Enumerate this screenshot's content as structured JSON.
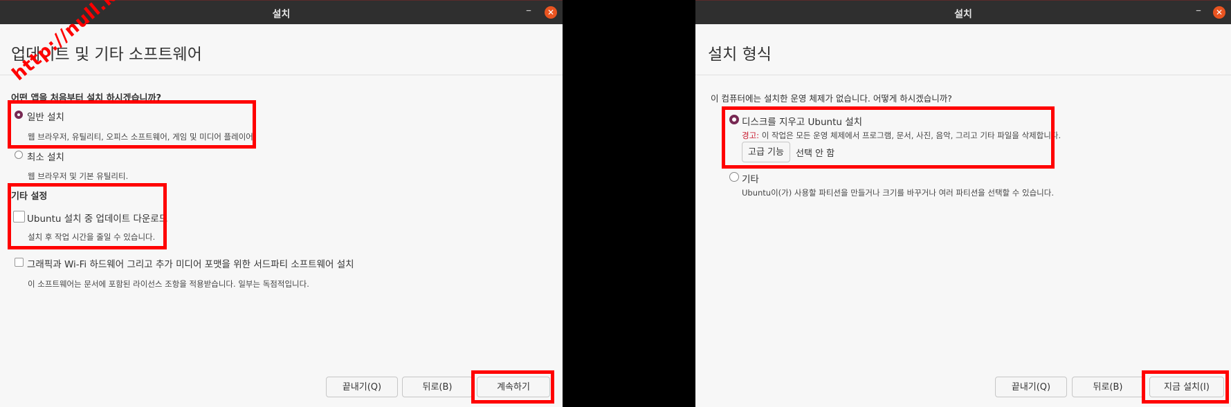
{
  "left": {
    "title": "설치",
    "minimize_glyph": "–",
    "close_glyph": "✕",
    "heading": "업데이트 및 기타 소프트웨어",
    "question": "어떤 앱을 처음부터 설치 하시겠습니까?",
    "normal_install": {
      "label": "일반 설치",
      "desc": "웹 브라우저, 유틸리티, 오피스 소프트웨어, 게임 및 미디어 플레이어.",
      "selected": true
    },
    "minimal_install": {
      "label": "최소 설치",
      "desc": "웹 브라우저 및 기본 유틸리티.",
      "selected": false
    },
    "other_settings": "기타 설정",
    "download_updates": {
      "label": "Ubuntu 설치 중 업데이트 다운로드",
      "desc": "설치 후 작업 시간을 줄일 수 있습니다.",
      "checked": false
    },
    "third_party": {
      "label": "그래픽과 Wi-Fi 하드웨어 그리고 추가 미디어 포맷을 위한 서드파티 소프트웨어 설치",
      "desc": "이 소프트웨어는 문서에 포함된 라이선스 조항을 적용받습니다. 일부는 독점적입니다.",
      "checked": false
    },
    "buttons": {
      "quit": "끝내기(Q)",
      "back": "뒤로(B)",
      "continue": "계속하기"
    }
  },
  "right": {
    "title": "설치",
    "minimize_glyph": "–",
    "close_glyph": "✕",
    "heading": "설치 형식",
    "question": "이 컴퓨터에는 설치한 운영 체제가 없습니다. 어떻게 하시겠습니까?",
    "erase_disk": {
      "label": "디스크를 지우고 Ubuntu 설치",
      "selected": true
    },
    "warning_label": "경고:",
    "warning_text": " 이 작업은 모든 운영 체제에서 프로그램, 문서, 사진, 음악, 그리고 기타 파일을 삭제합니다.",
    "advanced_button": "고급 기능",
    "advanced_status": "선택 안 함",
    "other": {
      "label": "기타",
      "desc": "Ubuntu이(가) 사용할 파티션을 만들거나 크기를 바꾸거나 여러 파티션을 선택할 수 있습니다.",
      "selected": false
    },
    "buttons": {
      "quit": "끝내기(Q)",
      "back": "뒤로(B)",
      "install_now": "지금 설치(I)"
    }
  },
  "watermark": "http://null.kr",
  "colors": {
    "highlight": "#ff0000",
    "ubuntu_orange": "#e95420",
    "radio_selected": "#772953",
    "titlebar": "#2f2f2f",
    "warning": "#c7162b"
  }
}
